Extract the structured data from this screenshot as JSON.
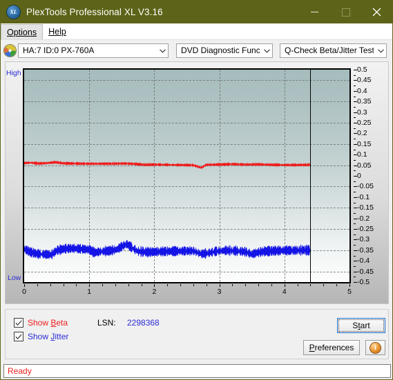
{
  "window": {
    "title": "PlexTools Professional XL V3.16",
    "icon": "xl-disc-icon",
    "controls": {
      "minimize": "minimize-icon",
      "maximize": "maximize-icon",
      "close": "close-icon"
    },
    "titlebar_color": "#5d6318"
  },
  "menubar": {
    "items": [
      {
        "label": "Options",
        "accel": "O"
      },
      {
        "label": "Help",
        "accel": "H"
      }
    ]
  },
  "toolbar": {
    "drive_icon": "disc-icon",
    "drive_select": {
      "value": "HA:7 ID:0  PX-760A"
    },
    "function_select": {
      "value": "DVD Diagnostic Functions"
    },
    "test_select": {
      "value": "Q-Check Beta/Jitter Test"
    }
  },
  "chart_data": {
    "type": "line",
    "title": "",
    "xlabel": "",
    "ylabel": "",
    "xlim": [
      0,
      5
    ],
    "ylim": [
      -0.5,
      0.5
    ],
    "grid": true,
    "legend_position": "bottom-left",
    "axis_left_label_top": "High",
    "axis_left_label_bottom": "Low",
    "xticks": [
      0,
      1,
      2,
      3,
      4,
      5
    ],
    "xtick_labels": [
      "0",
      "1",
      "2",
      "3",
      "4",
      "5"
    ],
    "x_minor_step": 0.2,
    "yticks": [
      0.5,
      0.45,
      0.4,
      0.35,
      0.3,
      0.25,
      0.2,
      0.15,
      0.1,
      0.05,
      0,
      -0.05,
      -0.1,
      -0.15,
      -0.2,
      -0.25,
      -0.3,
      -0.35,
      -0.4,
      -0.45,
      -0.5
    ],
    "ytick_labels": [
      "0.5",
      "0.45",
      "0.4",
      "0.35",
      "0.3",
      "0.25",
      "0.2",
      "0.15",
      "0.1",
      "0.05",
      "0",
      "-0.05",
      "-0.1",
      "-0.15",
      "-0.2",
      "-0.25",
      "-0.3",
      "-0.35",
      "-0.4",
      "-0.45",
      "-0.5"
    ],
    "gridline_values": [
      0.45,
      0.35,
      0.25,
      0.15,
      0.05,
      -0.05,
      -0.15,
      -0.25,
      -0.35,
      -0.45
    ],
    "cursor_x": 4.4,
    "data_end_x": 4.4,
    "plot_bg_gradient": [
      "#a5bcbd",
      "#fdfdfd"
    ],
    "series": [
      {
        "name": "Beta",
        "color": "#f01c1c",
        "x_start": 0,
        "x_end": 4.4,
        "mean": 0.055,
        "noise": 0.006,
        "control_points": [
          [
            0.0,
            0.06
          ],
          [
            0.1,
            0.062
          ],
          [
            0.22,
            0.058
          ],
          [
            0.35,
            0.06
          ],
          [
            0.48,
            0.064
          ],
          [
            0.6,
            0.059
          ],
          [
            0.75,
            0.058
          ],
          [
            0.95,
            0.057
          ],
          [
            1.15,
            0.057
          ],
          [
            1.35,
            0.057
          ],
          [
            1.55,
            0.058
          ],
          [
            1.7,
            0.056
          ],
          [
            1.85,
            0.052
          ],
          [
            2.0,
            0.053
          ],
          [
            2.2,
            0.052
          ],
          [
            2.4,
            0.051
          ],
          [
            2.6,
            0.05
          ],
          [
            2.72,
            0.038
          ],
          [
            2.8,
            0.052
          ],
          [
            3.0,
            0.053
          ],
          [
            3.2,
            0.055
          ],
          [
            3.4,
            0.053
          ],
          [
            3.6,
            0.054
          ],
          [
            3.8,
            0.052
          ],
          [
            4.0,
            0.051
          ],
          [
            4.2,
            0.051
          ],
          [
            4.4,
            0.052
          ]
        ]
      },
      {
        "name": "Jitter",
        "color": "#1414e6",
        "x_start": 0,
        "x_end": 4.4,
        "mean": -0.355,
        "noise": 0.022,
        "control_points": [
          [
            0.0,
            -0.345
          ],
          [
            0.1,
            -0.36
          ],
          [
            0.2,
            -0.368
          ],
          [
            0.32,
            -0.37
          ],
          [
            0.42,
            -0.372
          ],
          [
            0.5,
            -0.352
          ],
          [
            0.62,
            -0.344
          ],
          [
            0.75,
            -0.342
          ],
          [
            0.88,
            -0.345
          ],
          [
            1.0,
            -0.348
          ],
          [
            1.08,
            -0.362
          ],
          [
            1.18,
            -0.357
          ],
          [
            1.3,
            -0.354
          ],
          [
            1.42,
            -0.348
          ],
          [
            1.52,
            -0.33
          ],
          [
            1.58,
            -0.322
          ],
          [
            1.66,
            -0.34
          ],
          [
            1.75,
            -0.356
          ],
          [
            1.9,
            -0.36
          ],
          [
            2.05,
            -0.358
          ],
          [
            2.2,
            -0.356
          ],
          [
            2.4,
            -0.355
          ],
          [
            2.6,
            -0.354
          ],
          [
            2.72,
            -0.368
          ],
          [
            2.8,
            -0.366
          ],
          [
            2.95,
            -0.356
          ],
          [
            3.1,
            -0.352
          ],
          [
            3.25,
            -0.354
          ],
          [
            3.4,
            -0.358
          ],
          [
            3.5,
            -0.37
          ],
          [
            3.58,
            -0.362
          ],
          [
            3.7,
            -0.356
          ],
          [
            3.85,
            -0.354
          ],
          [
            4.0,
            -0.352
          ],
          [
            4.15,
            -0.352
          ],
          [
            4.3,
            -0.35
          ],
          [
            4.4,
            -0.352
          ]
        ]
      }
    ]
  },
  "controls": {
    "show_beta": {
      "label_prefix": "Show ",
      "label_accel": "B",
      "label_rest": "eta",
      "checked": true,
      "color": "#f01c1c"
    },
    "show_jitter": {
      "label_prefix": "Show ",
      "label_accel": "J",
      "label_rest": "itter",
      "checked": true,
      "color": "#2b2bd6"
    },
    "lsn_label": "LSN:",
    "lsn_value": "2298368",
    "start_button": {
      "prefix": "S",
      "accel": "t",
      "rest": "art",
      "label": "Start"
    },
    "preferences_button": {
      "accel": "P",
      "rest": "references",
      "label": "Preferences"
    },
    "info_button": {
      "icon": "info-icon",
      "glyph": "i"
    }
  },
  "statusbar": {
    "text": "Ready",
    "color": "#f01c1c"
  }
}
